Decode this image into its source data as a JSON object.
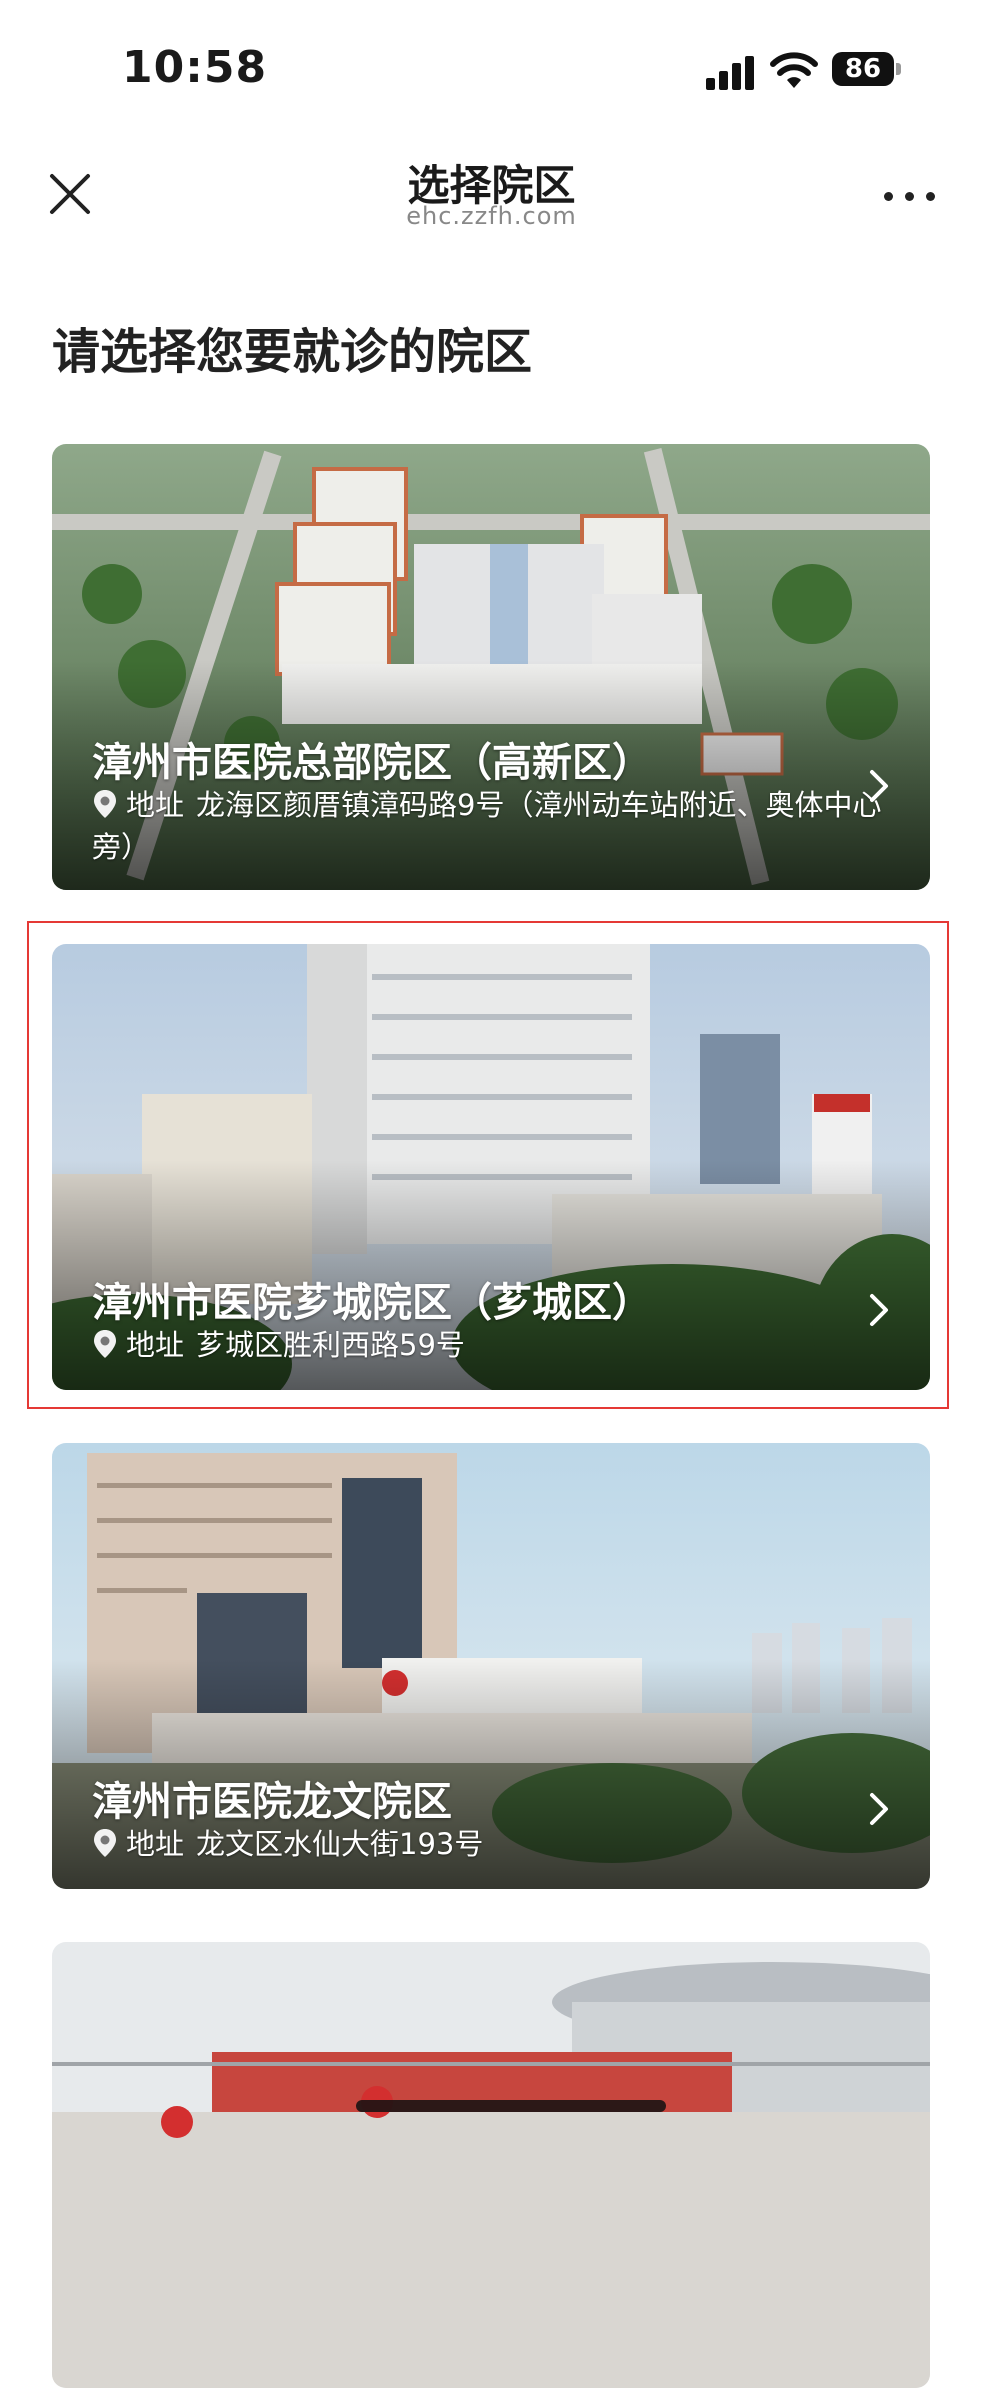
{
  "status_bar": {
    "time": "10:58",
    "battery": "86"
  },
  "nav": {
    "title": "选择院区",
    "subtitle": "ehc.zzfh.com",
    "close_icon": "close-icon",
    "more_icon": "more-icon"
  },
  "page": {
    "heading": "请选择您要就诊的院区"
  },
  "campuses": [
    {
      "name": "漳州市医院总部院区（高新区）",
      "address_label": "地址",
      "address": "龙海区颜厝镇漳码路9号（漳州动车站附近、奥体中心旁）"
    },
    {
      "name": "漳州市医院芗城院区（芗城区）",
      "address_label": "地址",
      "address": "芗城区胜利西路59号"
    },
    {
      "name": "漳州市医院龙文院区",
      "address_label": "地址",
      "address": "龙文区水仙大街193号"
    },
    {
      "name": "",
      "address_label": "",
      "address": ""
    }
  ],
  "colors": {
    "highlight": "#e53935"
  }
}
